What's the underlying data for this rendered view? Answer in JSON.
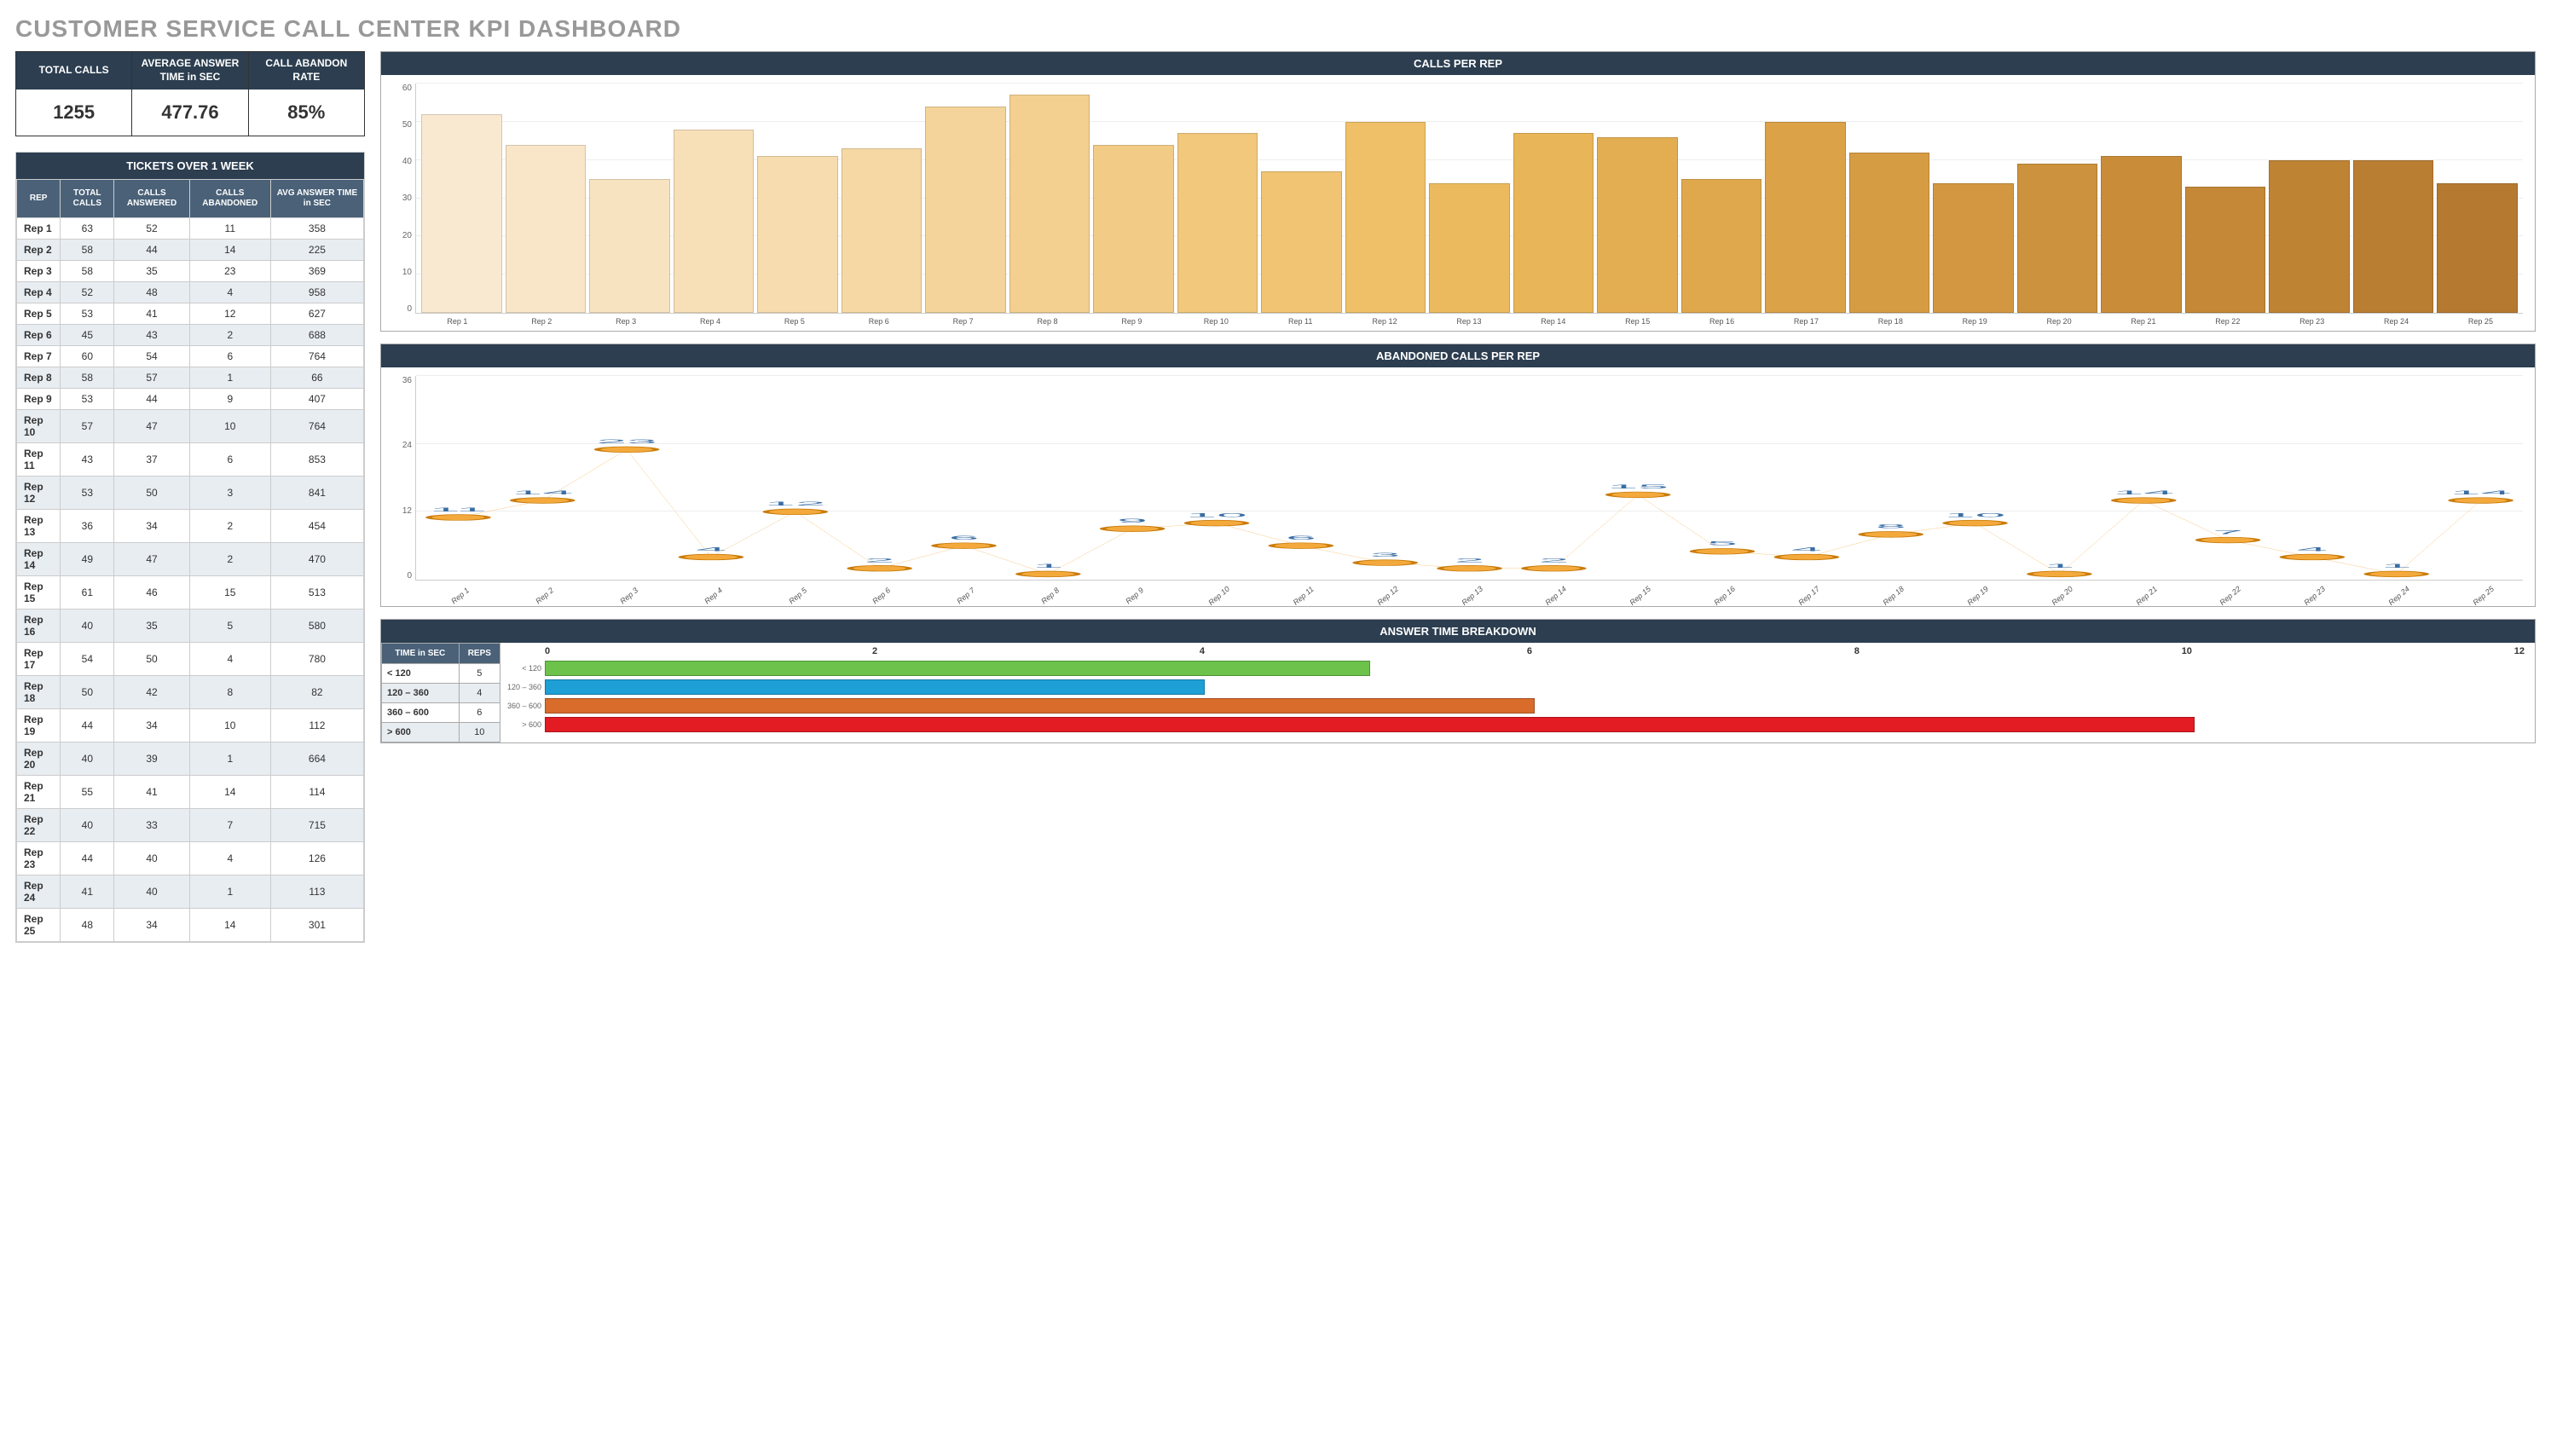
{
  "title": "CUSTOMER SERVICE CALL CENTER KPI DASHBOARD",
  "kpis": [
    {
      "label": "TOTAL CALLS",
      "value": "1255"
    },
    {
      "label": "AVERAGE ANSWER TIME in SEC",
      "value": "477.76"
    },
    {
      "label": "CALL ABANDON RATE",
      "value": "85%"
    }
  ],
  "tickets_title": "TICKETS OVER 1 WEEK",
  "tickets_headers": [
    "REP",
    "TOTAL CALLS",
    "CALLS ANSWERED",
    "CALLS ABANDONED",
    "AVG ANSWER TIME in SEC"
  ],
  "tickets": [
    {
      "rep": "Rep 1",
      "total": 63,
      "ans": 52,
      "abn": 11,
      "avg": 358
    },
    {
      "rep": "Rep 2",
      "total": 58,
      "ans": 44,
      "abn": 14,
      "avg": 225
    },
    {
      "rep": "Rep 3",
      "total": 58,
      "ans": 35,
      "abn": 23,
      "avg": 369
    },
    {
      "rep": "Rep 4",
      "total": 52,
      "ans": 48,
      "abn": 4,
      "avg": 958
    },
    {
      "rep": "Rep 5",
      "total": 53,
      "ans": 41,
      "abn": 12,
      "avg": 627
    },
    {
      "rep": "Rep 6",
      "total": 45,
      "ans": 43,
      "abn": 2,
      "avg": 688
    },
    {
      "rep": "Rep 7",
      "total": 60,
      "ans": 54,
      "abn": 6,
      "avg": 764
    },
    {
      "rep": "Rep 8",
      "total": 58,
      "ans": 57,
      "abn": 1,
      "avg": 66
    },
    {
      "rep": "Rep 9",
      "total": 53,
      "ans": 44,
      "abn": 9,
      "avg": 407
    },
    {
      "rep": "Rep 10",
      "total": 57,
      "ans": 47,
      "abn": 10,
      "avg": 764
    },
    {
      "rep": "Rep 11",
      "total": 43,
      "ans": 37,
      "abn": 6,
      "avg": 853
    },
    {
      "rep": "Rep 12",
      "total": 53,
      "ans": 50,
      "abn": 3,
      "avg": 841
    },
    {
      "rep": "Rep 13",
      "total": 36,
      "ans": 34,
      "abn": 2,
      "avg": 454
    },
    {
      "rep": "Rep 14",
      "total": 49,
      "ans": 47,
      "abn": 2,
      "avg": 470
    },
    {
      "rep": "Rep 15",
      "total": 61,
      "ans": 46,
      "abn": 15,
      "avg": 513
    },
    {
      "rep": "Rep 16",
      "total": 40,
      "ans": 35,
      "abn": 5,
      "avg": 580
    },
    {
      "rep": "Rep 17",
      "total": 54,
      "ans": 50,
      "abn": 4,
      "avg": 780
    },
    {
      "rep": "Rep 18",
      "total": 50,
      "ans": 42,
      "abn": 8,
      "avg": 82
    },
    {
      "rep": "Rep 19",
      "total": 44,
      "ans": 34,
      "abn": 10,
      "avg": 112
    },
    {
      "rep": "Rep 20",
      "total": 40,
      "ans": 39,
      "abn": 1,
      "avg": 664
    },
    {
      "rep": "Rep 21",
      "total": 55,
      "ans": 41,
      "abn": 14,
      "avg": 114
    },
    {
      "rep": "Rep 22",
      "total": 40,
      "ans": 33,
      "abn": 7,
      "avg": 715
    },
    {
      "rep": "Rep 23",
      "total": 44,
      "ans": 40,
      "abn": 4,
      "avg": 126
    },
    {
      "rep": "Rep 24",
      "total": 41,
      "ans": 40,
      "abn": 1,
      "avg": 113
    },
    {
      "rep": "Rep 25",
      "total": 48,
      "ans": 34,
      "abn": 14,
      "avg": 301
    }
  ],
  "chart_data": [
    {
      "id": "calls_per_rep",
      "type": "bar",
      "title": "CALLS PER REP",
      "categories": [
        "Rep 1",
        "Rep 2",
        "Rep 3",
        "Rep 4",
        "Rep 5",
        "Rep 6",
        "Rep 7",
        "Rep 8",
        "Rep 9",
        "Rep 10",
        "Rep 11",
        "Rep 12",
        "Rep 13",
        "Rep 14",
        "Rep 15",
        "Rep 16",
        "Rep 17",
        "Rep 18",
        "Rep 19",
        "Rep 20",
        "Rep 21",
        "Rep 22",
        "Rep 23",
        "Rep 24",
        "Rep 25"
      ],
      "values": [
        52,
        44,
        35,
        48,
        41,
        43,
        54,
        57,
        44,
        47,
        37,
        50,
        34,
        47,
        46,
        35,
        50,
        42,
        34,
        39,
        41,
        33,
        40,
        40,
        34
      ],
      "ylim": [
        0,
        60
      ],
      "yticks": [
        0,
        10,
        20,
        30,
        40,
        50,
        60
      ],
      "colors": [
        "#f9e9d0",
        "#f9e6c8",
        "#f8e3c0",
        "#f7e0b8",
        "#f6dcae",
        "#f5d8a4",
        "#f4d49a",
        "#f3d090",
        "#f2cc86",
        "#f1c87c",
        "#f0c472",
        "#efc068",
        "#ecba5e",
        "#e8b558",
        "#e3ae52",
        "#dfa84d",
        "#dba248",
        "#d69c44",
        "#d29740",
        "#cd923d",
        "#c98d3a",
        "#c48837",
        "#bf8334",
        "#ba7e32",
        "#b57930"
      ]
    },
    {
      "id": "abandoned_per_rep",
      "type": "line",
      "title": "ABANDONED CALLS PER REP",
      "categories": [
        "Rep 1",
        "Rep 2",
        "Rep 3",
        "Rep 4",
        "Rep 5",
        "Rep 6",
        "Rep 7",
        "Rep 8",
        "Rep 9",
        "Rep 10",
        "Rep 11",
        "Rep 12",
        "Rep 13",
        "Rep 14",
        "Rep 15",
        "Rep 16",
        "Rep 17",
        "Rep 18",
        "Rep 19",
        "Rep 20",
        "Rep 21",
        "Rep 22",
        "Rep 23",
        "Rep 24",
        "Rep 25"
      ],
      "values": [
        11,
        14,
        23,
        4,
        12,
        2,
        6,
        1,
        9,
        10,
        6,
        3,
        2,
        2,
        15,
        5,
        4,
        8,
        10,
        1,
        14,
        7,
        4,
        1,
        14
      ],
      "ylim": [
        0,
        36
      ],
      "yticks": [
        0,
        12,
        24,
        36
      ],
      "line_color": "#f4a93c",
      "marker_fill": "#f4a93c",
      "marker_stroke": "#c97c0a"
    },
    {
      "id": "answer_time_breakdown",
      "type": "bar",
      "orientation": "horizontal",
      "title": "ANSWER TIME BREAKDOWN",
      "table_headers": [
        "TIME in SEC",
        "REPS"
      ],
      "rows": [
        {
          "range": "< 120",
          "reps": 5,
          "color": "#6cc24a"
        },
        {
          "range": "120 – 360",
          "reps": 4,
          "color": "#1e9fd6"
        },
        {
          "range": "360 – 600",
          "reps": 6,
          "color": "#d96b2b"
        },
        {
          "range": "> 600",
          "reps": 10,
          "color": "#e31b23"
        }
      ],
      "xlim": [
        0,
        12
      ],
      "xticks": [
        0,
        2,
        4,
        6,
        8,
        10,
        12
      ]
    }
  ]
}
